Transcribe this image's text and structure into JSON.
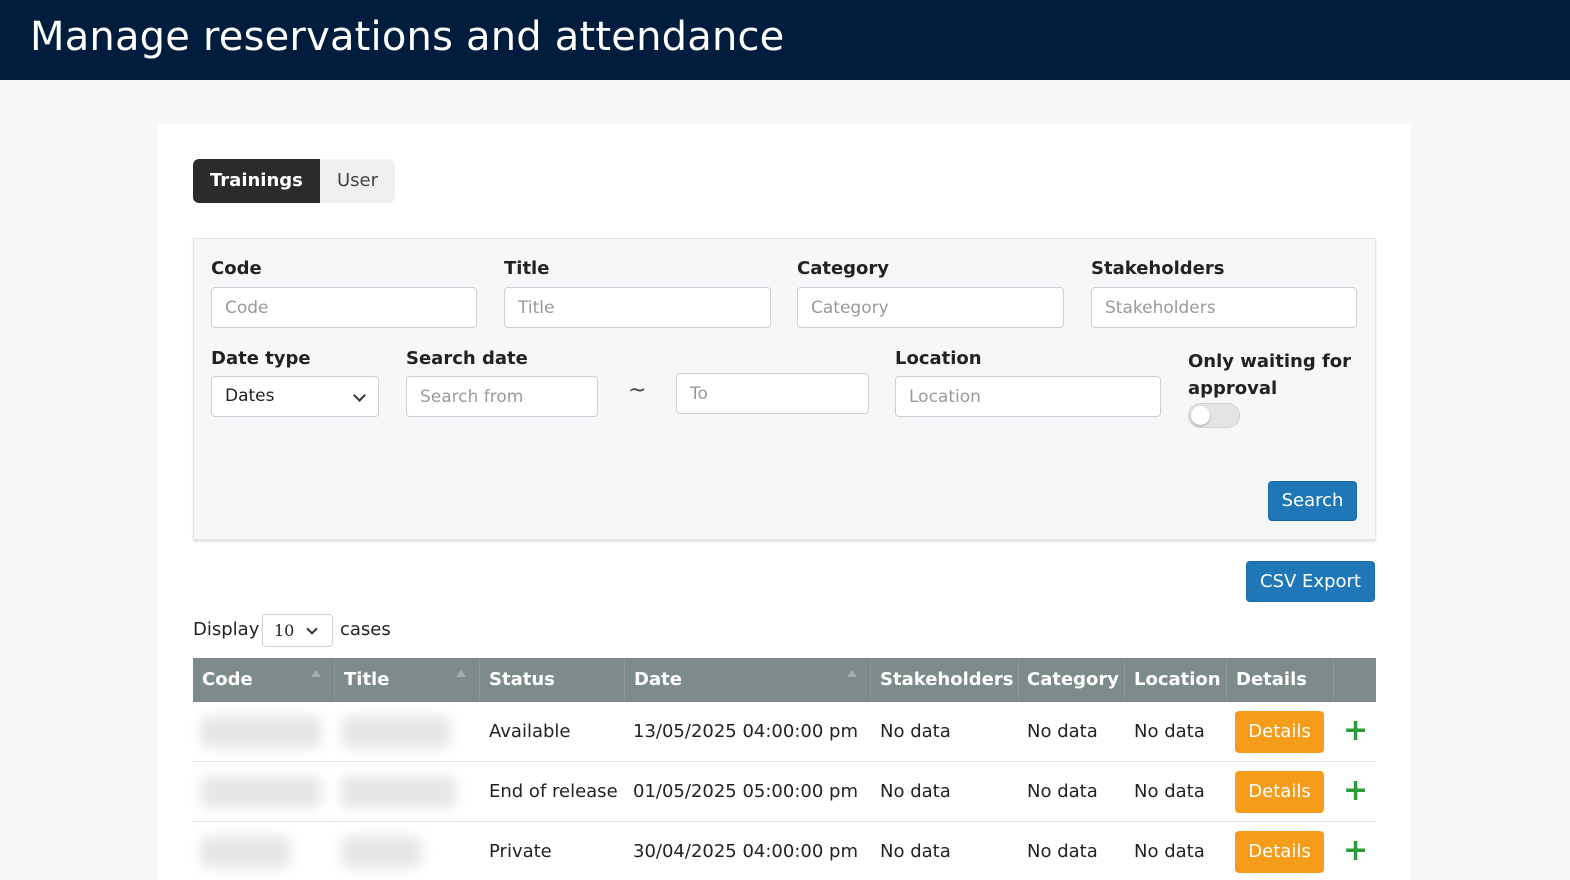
{
  "header": {
    "title": "Manage reservations and attendance"
  },
  "tabs": [
    {
      "label": "Trainings",
      "active": true
    },
    {
      "label": "User",
      "active": false
    }
  ],
  "filters": {
    "code": {
      "label": "Code",
      "placeholder": "Code"
    },
    "title": {
      "label": "Title",
      "placeholder": "Title"
    },
    "category": {
      "label": "Category",
      "placeholder": "Category"
    },
    "stakeholders": {
      "label": "Stakeholders",
      "placeholder": "Stakeholders"
    },
    "date_type": {
      "label": "Date type",
      "value": "Dates"
    },
    "search_date": {
      "label": "Search date",
      "from_placeholder": "Search from",
      "separator": "~",
      "to_placeholder": "To"
    },
    "location": {
      "label": "Location",
      "placeholder": "Location"
    },
    "waiting_approval": {
      "label_line1": "Only waiting for",
      "label_line2": "approval",
      "checked": false
    },
    "search_button": "Search"
  },
  "csv_export_label": "CSV Export",
  "display": {
    "prefix": "Display",
    "value": "10",
    "suffix": "cases"
  },
  "table": {
    "columns": [
      "Code",
      "Title",
      "Status",
      "Date",
      "Stakeholders",
      "Category",
      "Location",
      "Details"
    ],
    "rows": [
      {
        "status": "Available",
        "date": "13/05/2025 04:00:00 pm",
        "stakeholders": "No data",
        "category": "No data",
        "location": "No data",
        "details_label": "Details"
      },
      {
        "status": "End of release",
        "date": "01/05/2025 05:00:00 pm",
        "stakeholders": "No data",
        "category": "No data",
        "location": "No data",
        "details_label": "Details"
      },
      {
        "status": "Private",
        "date": "30/04/2025 04:00:00 pm",
        "stakeholders": "No data",
        "category": "No data",
        "location": "No data",
        "details_label": "Details"
      }
    ],
    "expand_symbol": "+"
  },
  "colors": {
    "header_bg": "#001d3d",
    "primary": "#2077b8",
    "details": "#f59c1a",
    "expand": "#2e9b3a",
    "table_head": "#7d8b8b"
  },
  "icons": {
    "dropdown": "chevron-down-icon",
    "expand": "plus-icon",
    "sort": "sort-icon"
  }
}
